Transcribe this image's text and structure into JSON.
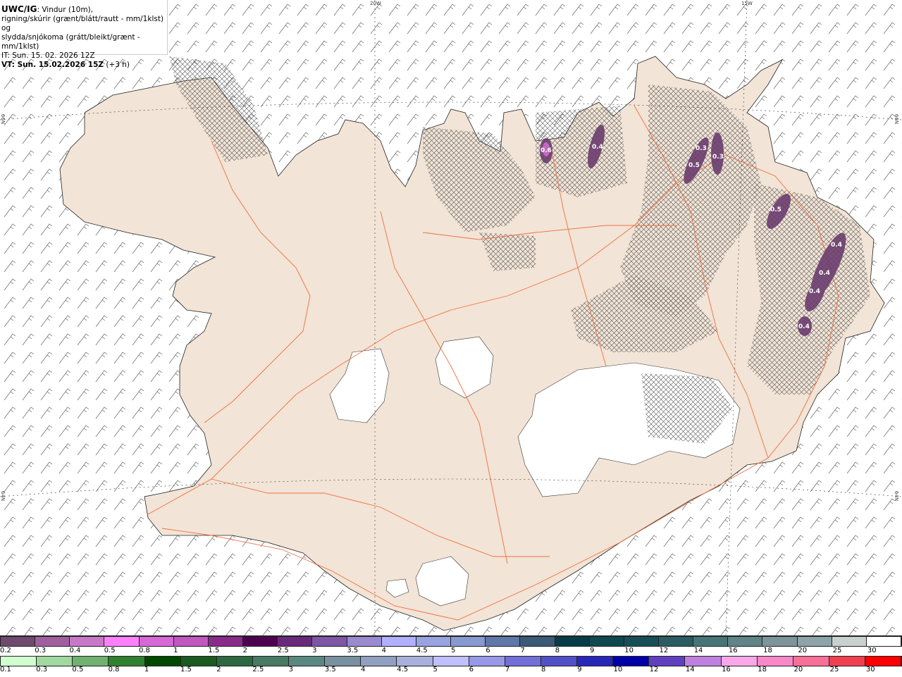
{
  "info": {
    "product": "UWC/IG",
    "line1": ": Vindur (10m),",
    "line2": "rigning/skúrir (grænt/blátt/rautt - mm/1klst) og",
    "line3": "slydda/snjókoma (grátt/bleikt/grænt - mm/1klst)",
    "it": "IT: Sun. 15. 02. 2026 12Z",
    "vt": "VT: Sun. 15.02.2026 15Z",
    "vt_offset": " (+3 h)"
  },
  "grid_labels": {
    "lon_20w": "20W",
    "lon_15w": "15W",
    "lat_66n_left": "66N",
    "lat_64n_left": "64N",
    "lat_66n_right": "66N",
    "lat_64n_right": "64N"
  },
  "precip_labels": [
    "0.6",
    "0.4",
    "0.3",
    "0.3",
    "0.5",
    "0.5",
    "0.4",
    "0.4",
    "0.4",
    "0.4"
  ],
  "legend_top": {
    "labels": [
      "0.2",
      "0.3",
      "0.4",
      "0.5",
      "0.8",
      "1",
      "1.5",
      "2",
      "2.5",
      "3",
      "3.5",
      "4",
      "4.5",
      "5",
      "6",
      "7",
      "8",
      "9",
      "10",
      "12",
      "14",
      "16",
      "18",
      "20",
      "25",
      "30"
    ],
    "colors": [
      "#6e4a6e",
      "#a060a0",
      "#c878c8",
      "#ff80ff",
      "#d868d8",
      "#c058c0",
      "#8a2a8a",
      "#500050",
      "#6a2a7a",
      "#7e56a6",
      "#9a8ad0",
      "#b0b0ff",
      "#98a4e0",
      "#8898d0",
      "#6078a8",
      "#3a5a78",
      "#083c48",
      "#104850",
      "#184e58",
      "#2a5c64",
      "#487478",
      "#608488",
      "#7e9498",
      "#8ea4a8",
      "#c8d0d0",
      "#ffffff"
    ]
  },
  "legend_bottom": {
    "labels": [
      "0.1",
      "0.3",
      "0.5",
      "0.8",
      "1",
      "1.5",
      "2",
      "2.5",
      "3",
      "3.5",
      "4",
      "4.5",
      "5",
      "6",
      "7",
      "8",
      "9",
      "10",
      "12",
      "14",
      "16",
      "18",
      "20",
      "25",
      "30"
    ],
    "colors": [
      "#d0ffd0",
      "#a0d8a0",
      "#70b070",
      "#308030",
      "#004800",
      "#1a5a20",
      "#2e6840",
      "#487a64",
      "#5a8880",
      "#7890a0",
      "#90a0c0",
      "#a8b0dc",
      "#c0c0ff",
      "#9898e8",
      "#7070d8",
      "#5050c8",
      "#2828b8",
      "#0000a8",
      "#6040c0",
      "#c080e0",
      "#f8a8e8",
      "#f888c8",
      "#f87098",
      "#f04050",
      "#ff0000"
    ]
  },
  "colors": {
    "land": "#f2e4d6",
    "roads": "#f07040",
    "glacier": "#ffffff",
    "precip": "#6a3c6e"
  }
}
